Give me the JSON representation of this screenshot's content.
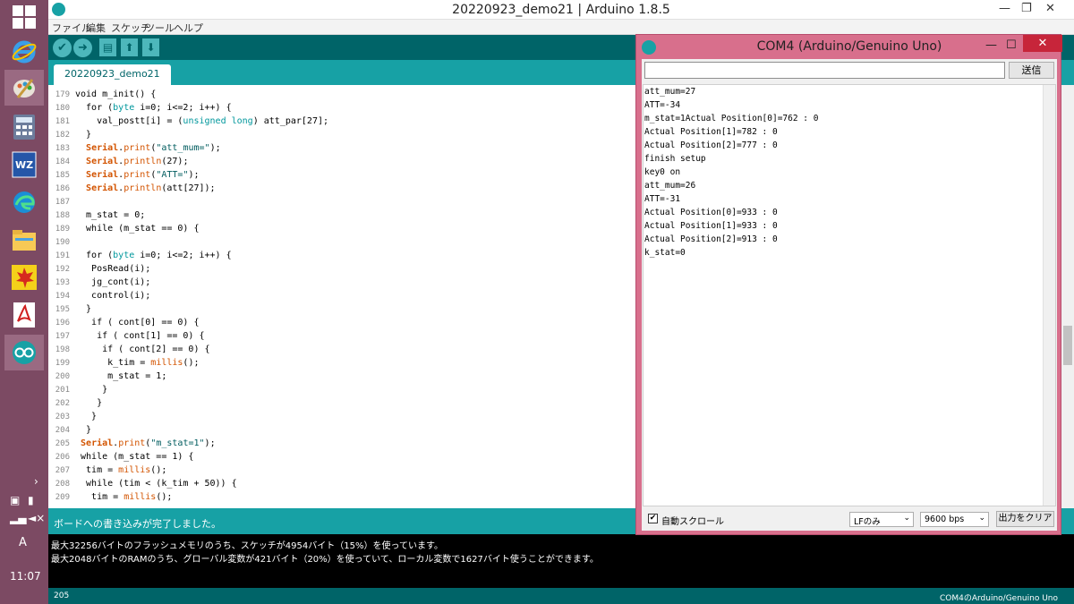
{
  "window": {
    "title": "20220923_demo21 | Arduino 1.8.5"
  },
  "menu": [
    "ファイル",
    "編集",
    "スケッチ",
    "ツール",
    "ヘルプ"
  ],
  "toolbar": {
    "verify_icon": "check-icon",
    "upload_icon": "arrow-right-icon",
    "new_icon": "new-file-icon",
    "open_icon": "up-arrow-icon",
    "save_icon": "down-arrow-icon"
  },
  "tab": {
    "label": "20220923_demo21"
  },
  "code": {
    "lines": [
      {
        "n": "179",
        "t": "void m_init() {"
      },
      {
        "n": "180",
        "t": "  for (byte i=0; i<=2; i++) {"
      },
      {
        "n": "181",
        "t": "    val_postt[i] = (unsigned long) att_par[27];"
      },
      {
        "n": "182",
        "t": "  }"
      },
      {
        "n": "183",
        "t": "  Serial.print(\"att_mum=\");"
      },
      {
        "n": "184",
        "t": "  Serial.println(27);"
      },
      {
        "n": "185",
        "t": "  Serial.print(\"ATT=\");"
      },
      {
        "n": "186",
        "t": "  Serial.println(att[27]);"
      },
      {
        "n": "187",
        "t": ""
      },
      {
        "n": "188",
        "t": "  m_stat = 0;"
      },
      {
        "n": "189",
        "t": "  while (m_stat == 0) {"
      },
      {
        "n": "190",
        "t": ""
      },
      {
        "n": "191",
        "t": "  for (byte i=0; i<=2; i++) {"
      },
      {
        "n": "192",
        "t": "   PosRead(i);"
      },
      {
        "n": "193",
        "t": "   jg_cont(i);"
      },
      {
        "n": "194",
        "t": "   control(i);"
      },
      {
        "n": "195",
        "t": "  }"
      },
      {
        "n": "196",
        "t": "   if ( cont[0] == 0) {"
      },
      {
        "n": "197",
        "t": "    if ( cont[1] == 0) {"
      },
      {
        "n": "198",
        "t": "     if ( cont[2] == 0) {"
      },
      {
        "n": "199",
        "t": "      k_tim = millis();"
      },
      {
        "n": "200",
        "t": "      m_stat = 1;"
      },
      {
        "n": "201",
        "t": "     }"
      },
      {
        "n": "202",
        "t": "    }"
      },
      {
        "n": "203",
        "t": "   }"
      },
      {
        "n": "204",
        "t": "  }"
      },
      {
        "n": "205",
        "t": " Serial.print(\"m_stat=1\");"
      },
      {
        "n": "206",
        "t": " while (m_stat == 1) {"
      },
      {
        "n": "207",
        "t": "  tim = millis();"
      },
      {
        "n": "208",
        "t": "  while (tim < (k_tim + 50)) {"
      },
      {
        "n": "209",
        "t": "   tim = millis();"
      }
    ]
  },
  "status": {
    "message": "ボードへの書き込みが完了しました。"
  },
  "console": {
    "lines": [
      "最大32256バイトのフラッシュメモリのうち、スケッチが4954バイト（15%）を使っています。",
      "最大2048バイトのRAMのうち、グローバル変数が421バイト（20%）を使っていて、ローカル変数で1627バイト使うことができます。"
    ]
  },
  "bottombar": {
    "line": "205",
    "board": "COM4のArduino/Genuino Uno"
  },
  "serial": {
    "title": "COM4 (Arduino/Genuino Uno)",
    "input_value": "",
    "send_label": "送信",
    "output": [
      "att_mum=27",
      "ATT=-34",
      "m_stat=1Actual Position[0]=762 : 0",
      "Actual Position[1]=782 : 0",
      "Actual Position[2]=777 : 0",
      "finish setup",
      "key0 on",
      "att_mum=26",
      "ATT=-31",
      "Actual Position[0]=933 : 0",
      "Actual Position[1]=933 : 0",
      "Actual Position[2]=913 : 0",
      "k_stat=0"
    ],
    "autoscroll_label": "自動スクロール",
    "autoscroll_checked": "✔",
    "line_ending": "LFのみ",
    "baud": "9600 bps",
    "clear_label": "出力をクリア"
  },
  "tray": {
    "time": "11:07",
    "ime": "A"
  },
  "colors": {
    "accent": "#17a1a5",
    "dark": "#006468",
    "serial_frame": "#d86f8c",
    "taskbar": "#7c4a63"
  }
}
